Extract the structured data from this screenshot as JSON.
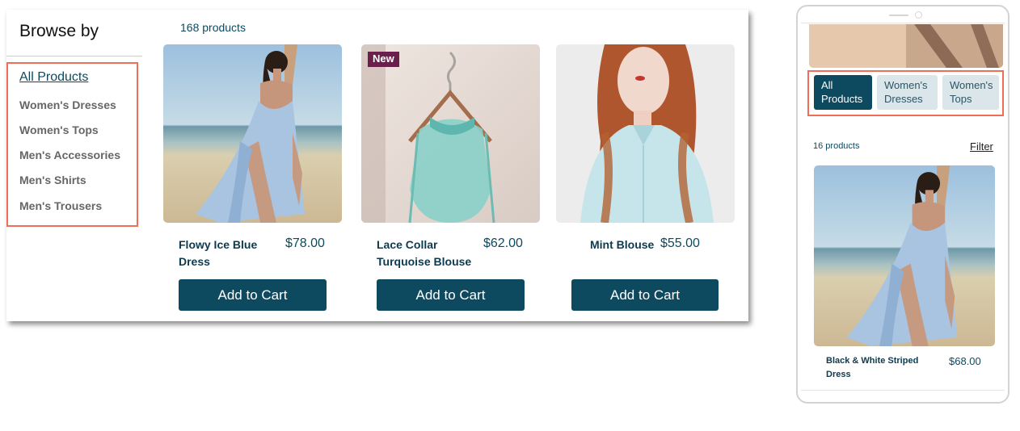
{
  "browse": {
    "title": "Browse by",
    "categories": [
      {
        "label": "All Products",
        "active": true
      },
      {
        "label": "Women's Dresses",
        "active": false
      },
      {
        "label": "Women's Tops",
        "active": false
      },
      {
        "label": "Men's Accessories",
        "active": false
      },
      {
        "label": "Men's Shirts",
        "active": false
      },
      {
        "label": "Men's Trousers",
        "active": false
      }
    ]
  },
  "gallery": {
    "count_label": "168 products",
    "add_to_cart_label": "Add to Cart",
    "products": [
      {
        "name_line1": "Flowy Ice Blue",
        "name_line2": "Dress",
        "price": "$78.00",
        "badge": ""
      },
      {
        "name_line1": "Lace Collar",
        "name_line2": "Turquoise Blouse",
        "price": "$62.00",
        "badge": "New"
      },
      {
        "name_line1": "Mint Blouse",
        "name_line2": "",
        "price": "$55.00",
        "badge": ""
      }
    ]
  },
  "mobile": {
    "chips": [
      {
        "line1": "All",
        "line2": "Products",
        "active": true
      },
      {
        "line1": "Women's",
        "line2": "Dresses",
        "active": false
      },
      {
        "line1": "Women's",
        "line2": "Tops",
        "active": false
      }
    ],
    "count_label": "16 products",
    "filter_label": "Filter",
    "product": {
      "name_line1": "Black & White Striped",
      "name_line2": "Dress",
      "price": "$68.00"
    }
  },
  "colors": {
    "accent": "#0d4a60",
    "highlight_box": "#ee6f55",
    "badge": "#6a1f4c",
    "chip_inactive": "#dae6ea"
  }
}
